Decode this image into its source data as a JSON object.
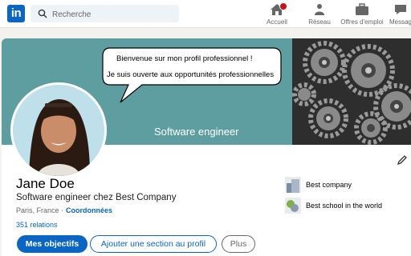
{
  "nav": {
    "logo_text": "in",
    "search_placeholder": "Recherche",
    "items": [
      {
        "label": "Accueil",
        "icon": "home-icon",
        "has_notification": true
      },
      {
        "label": "Réseau",
        "icon": "people-icon"
      },
      {
        "label": "Offres d'emploi",
        "icon": "briefcase-icon"
      },
      {
        "label": "Messag",
        "icon": "message-icon"
      }
    ]
  },
  "banner": {
    "bubble_line1": "Bienvenue sur mon profil professionnel !",
    "bubble_line2": "Je suis ouverte aux opportunités professionnelles",
    "caption": "Software engineer"
  },
  "profile": {
    "name": "Jane Doe",
    "headline": "Software engineer chez Best Company",
    "location": "Paris, France ·",
    "contact_link": "Coordonnées",
    "relations": "351 relations"
  },
  "actions": {
    "primary": "Mes objectifs",
    "add_section": "Ajouter une section au profil",
    "more": "Plus"
  },
  "experience": [
    {
      "label": "Best company",
      "icon": "company-logo-icon"
    },
    {
      "label": "Best school in the world",
      "icon": "school-logo-icon"
    }
  ],
  "colors": {
    "brand": "#0a66c2",
    "banner": "#5f9ea0",
    "notification": "#cc1016"
  }
}
